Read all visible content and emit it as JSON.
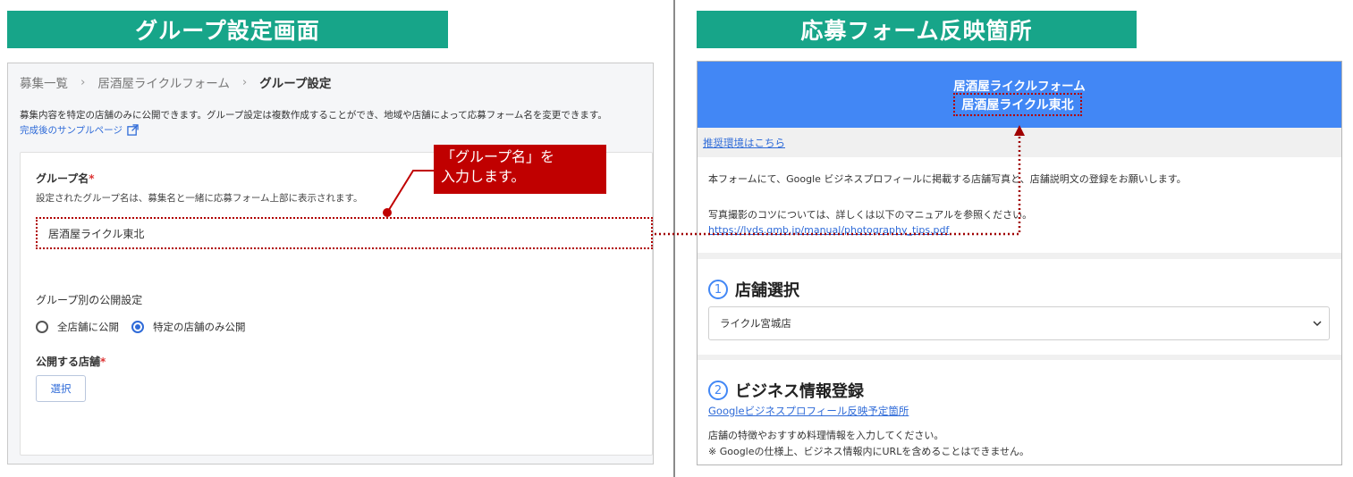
{
  "left_panel": {
    "banner": "グループ設定画面",
    "breadcrumb": [
      "募集一覧",
      "居酒屋ライクルフォーム",
      "グループ設定"
    ],
    "breadcrumb_sep": "›",
    "description": "募集内容を特定の店舗のみに公開できます。グループ設定は複数作成することができ、地域や店舗によって応募フォーム名を変更できます。",
    "sample_link": "完成後のサンプルページ",
    "group_name_label": "グループ名",
    "required_mark": "*",
    "group_name_help": "設定されたグループ名は、募集名と一緒に応募フォーム上部に表示されます。",
    "group_name_value": "居酒屋ライクル東北",
    "visibility_label": "グループ別の公開設定",
    "radio_all": "全店舗に公開",
    "radio_specific": "特定の店舗のみ公開",
    "stores_label": "公開する店舗",
    "select_button": "選択"
  },
  "callout": {
    "line1": "「グループ名」を",
    "line2": "入力します。"
  },
  "right_panel": {
    "banner": "応募フォーム反映箇所",
    "form_title": "居酒屋ライクルフォーム",
    "form_subtitle": "居酒屋ライクル東北",
    "env_link": "推奨環境はこちら",
    "intro_text": "本フォームにて、Google ビジネスプロフィールに掲載する店舗写真と、店舗説明文の登録をお願いします。",
    "photo_tip": "写真撮影のコツについては、詳しくは以下のマニュアルを参照ください。",
    "manual_url": "https://lyds.gmb.jp/manual/photography_tips.pdf",
    "section1_num": "1",
    "section1_title": "店舗選択",
    "store_value": "ライクル宮城店",
    "section2_num": "2",
    "section2_title": "ビジネス情報登録",
    "google_link": "Googleビジネスプロフィール反映予定箇所",
    "info_line1": "店舗の特徴やおすすめ料理情報を入力してください。",
    "info_line2": "※ Googleの仕様上、ビジネス情報内にURLを含めることはできません。"
  },
  "colors": {
    "banner": "#17a589",
    "callout": "#c00000",
    "form_header": "#4287f5",
    "link": "#2f6bd8"
  }
}
